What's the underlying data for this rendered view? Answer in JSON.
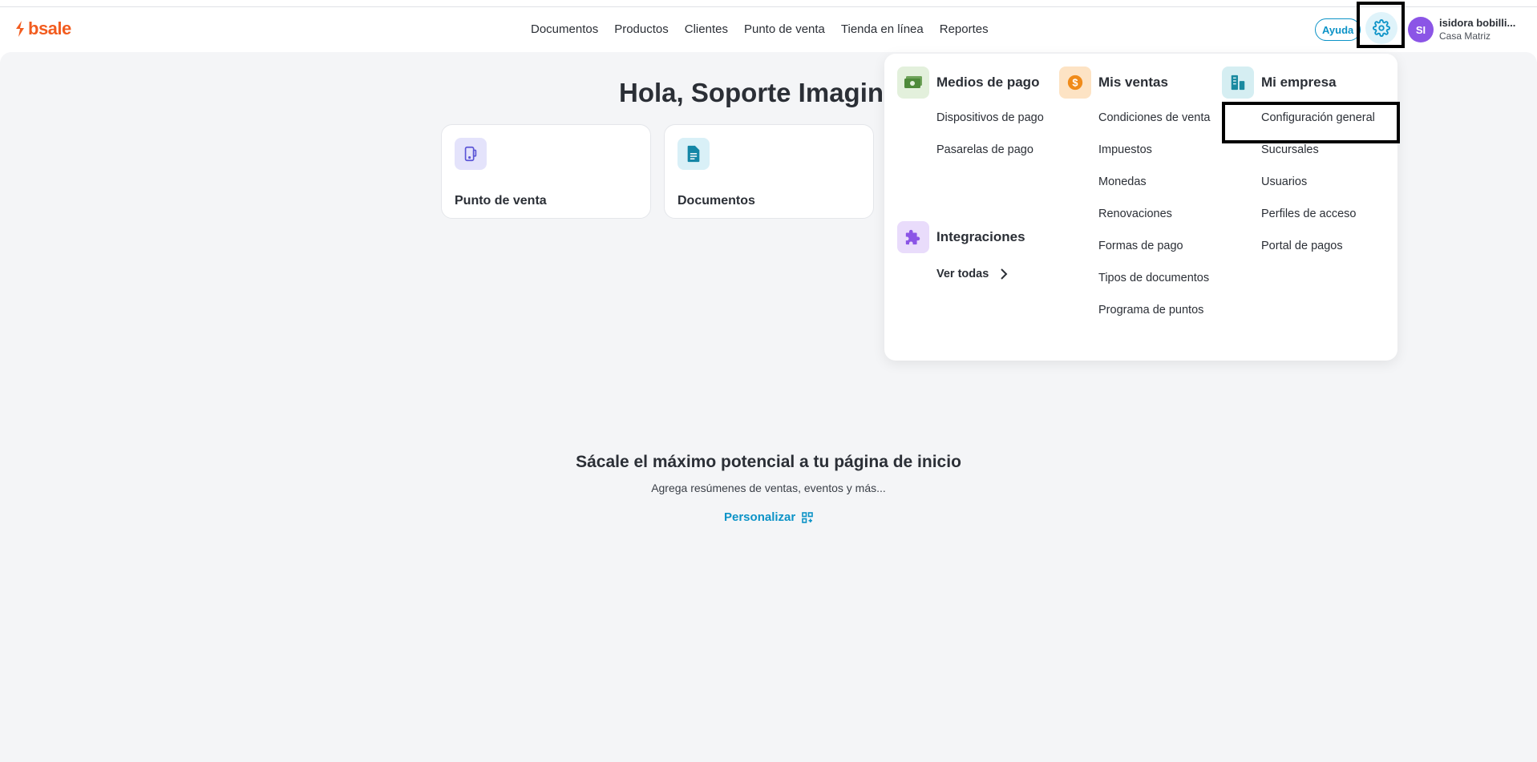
{
  "brand": {
    "name": "bsale",
    "color": "#f25c1f"
  },
  "nav": {
    "items": [
      {
        "label": "Documentos"
      },
      {
        "label": "Productos"
      },
      {
        "label": "Clientes"
      },
      {
        "label": "Punto de venta"
      },
      {
        "label": "Tienda en línea"
      },
      {
        "label": "Reportes"
      }
    ]
  },
  "header": {
    "help_label": "Ayuda",
    "settings_icon": "gear-icon",
    "user": {
      "initials": "SI",
      "name": "isidora bobilli...",
      "branch": "Casa Matriz"
    }
  },
  "home": {
    "greeting": "Hola, Soporte Imagin",
    "cards": [
      {
        "title": "Punto de venta",
        "icon": "pos-terminal-icon"
      },
      {
        "title": "Documentos",
        "icon": "document-icon"
      }
    ],
    "promo": {
      "title": "Sácale el máximo potencial a tu página de inicio",
      "subtitle": "Agrega resúmenes de ventas, eventos y más...",
      "action_label": "Personalizar"
    }
  },
  "settings_menu": {
    "payments": {
      "title": "Medios de pago",
      "items": [
        "Dispositivos de pago",
        "Pasarelas de pago"
      ]
    },
    "integrations": {
      "title": "Integraciones",
      "see_all_label": "Ver todas"
    },
    "sales": {
      "title": "Mis ventas",
      "items": [
        "Condiciones de venta",
        "Impuestos",
        "Monedas",
        "Renovaciones",
        "Formas de pago",
        "Tipos de documentos",
        "Programa de puntos"
      ]
    },
    "company": {
      "title": "Mi empresa",
      "items": [
        "Configuración general",
        "Sucursales",
        "Usuarios",
        "Perfiles de acceso",
        "Portal de pagos"
      ]
    }
  },
  "colors": {
    "accent": "#0c93c7",
    "avatar": "#8b55e6",
    "payments_icon_bg": "#e3f0dc",
    "sales_icon_bg": "#fde3c4",
    "company_icon_bg": "#d5eef2",
    "integrations_icon_bg": "#e9dcfb"
  }
}
